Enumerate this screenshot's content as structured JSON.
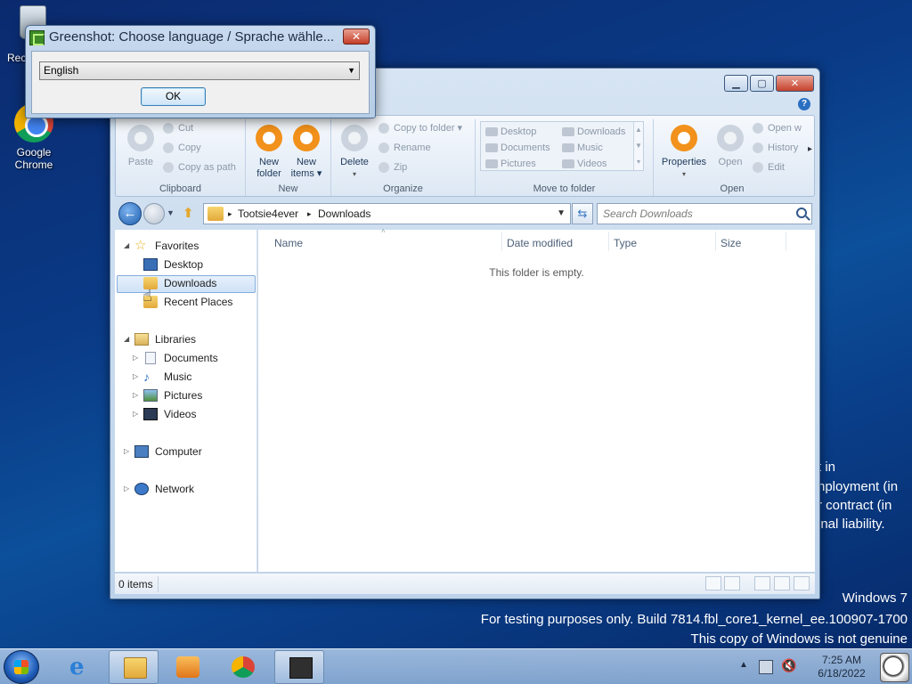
{
  "desktop": {
    "icons": [
      {
        "label": "Rec"
      },
      {
        "label": "Google\nChrome",
        "line1": "Google",
        "line2": "Chrome"
      }
    ],
    "watermark": {
      "line1": "Windows 7",
      "line2": "For testing purposes only. Build 7814.fbl_core1_kernel_ee.100907-1700",
      "line3": "This copy of Windows is not genuine"
    },
    "background_fragments": [
      "t in",
      "nployment (in",
      "r contract (in",
      "inal liability."
    ]
  },
  "dialog": {
    "title": "Greenshot: Choose language / Sprache wähle...",
    "close_label": "✕",
    "language_selected": "English",
    "ok_label": "OK"
  },
  "explorer": {
    "ribbon": {
      "clipboard": {
        "paste": "Paste",
        "cut": "Cut",
        "copy": "Copy",
        "copy_as_path": "Copy as path",
        "label": "Clipboard"
      },
      "new": {
        "new_folder_1": "New",
        "new_folder_2": "folder",
        "new_items_1": "New",
        "new_items_2": "items ▾",
        "label": "New"
      },
      "organize": {
        "delete": "Delete",
        "copy_to_folder": "Copy to folder ▾",
        "rename": "Rename",
        "zip": "Zip",
        "label": "Organize"
      },
      "move_to_folder": {
        "items": [
          "Desktop",
          "Downloads",
          "Documents",
          "Music",
          "Pictures",
          "Videos"
        ],
        "label": "Move to folder"
      },
      "open": {
        "properties": "Properties",
        "open": "Open",
        "open_with": "Open w",
        "history": "History",
        "edit": "Edit",
        "label": "Open"
      }
    },
    "address": {
      "crumbs": [
        "Tootsie4ever",
        "Downloads"
      ],
      "search_placeholder": "Search Downloads"
    },
    "navpane": {
      "favorites": "Favorites",
      "favorites_items": [
        "Desktop",
        "Downloads",
        "Recent Places"
      ],
      "libraries": "Libraries",
      "libraries_items": [
        "Documents",
        "Music",
        "Pictures",
        "Videos"
      ],
      "computer": "Computer",
      "network": "Network"
    },
    "columns": [
      "Name",
      "Date modified",
      "Type",
      "Size"
    ],
    "empty_message": "This folder is empty.",
    "status": "0 items"
  },
  "taskbar": {
    "time": "7:25 AM",
    "date": "6/18/2022"
  },
  "colors": {
    "ribbon_accent": "#f2911b",
    "selection": "#cfe2f7",
    "desktop": "#0a3a86"
  }
}
